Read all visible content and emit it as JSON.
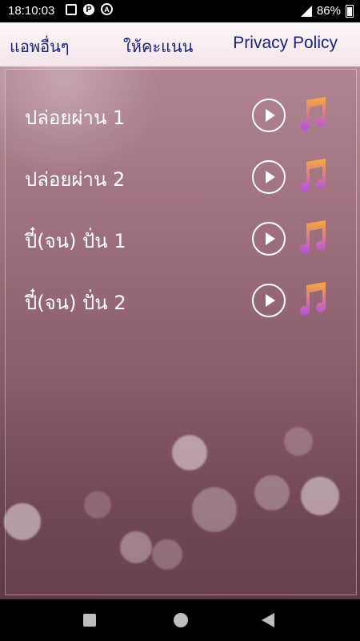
{
  "status_bar": {
    "time": "18:10:03",
    "battery": "86%",
    "icons": [
      "photo-icon",
      "p-icon",
      "a-icon",
      "signal-icon",
      "battery-icon"
    ]
  },
  "menu": {
    "other_apps": "แอพอื่นๆ",
    "rate": "ให้คะแนน",
    "privacy": "Privacy Policy"
  },
  "songs": [
    {
      "title": "ปล่อยผ่าน 1"
    },
    {
      "title": "ปล่อยผ่าน 2"
    },
    {
      "title": "ปี๋(จน) ปั่น 1"
    },
    {
      "title": "ปี๋(จน) ปั่น 2"
    }
  ],
  "colors": {
    "menu_text": "#1a237e",
    "menu_bg": "#fdf6f8",
    "bg_top": "#b78c98",
    "bg_bottom": "#5f3946"
  }
}
